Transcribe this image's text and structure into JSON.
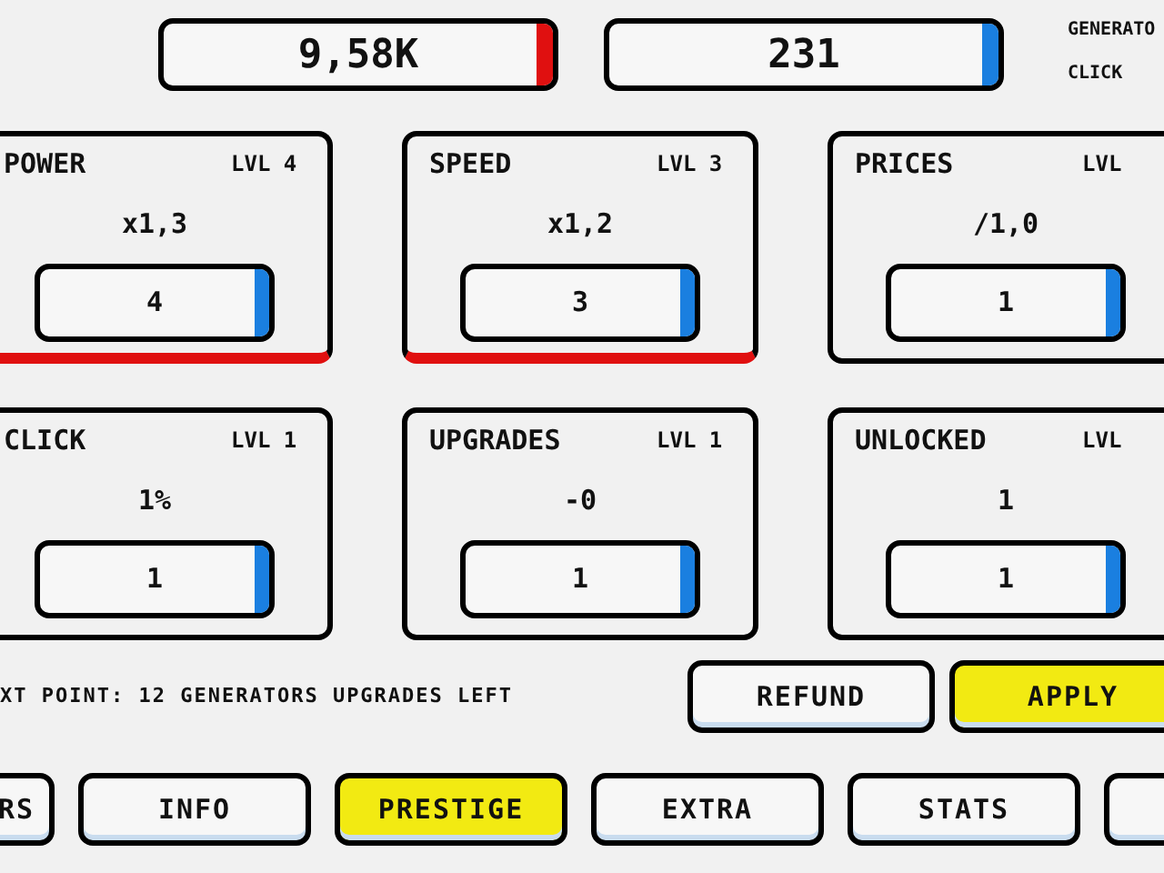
{
  "counters": [
    {
      "value": "9,58K",
      "color": "#e01010"
    },
    {
      "value": "231",
      "color": "#1a7fe0"
    }
  ],
  "counter_labels": [
    "GENERATO",
    "CLICK"
  ],
  "cards": [
    {
      "title": "POWER",
      "level_label": "LVL 4",
      "effect": "x1,3",
      "points": "4",
      "highlighted": true
    },
    {
      "title": "SPEED",
      "level_label": "LVL 3",
      "effect": "x1,2",
      "points": "3",
      "highlighted": true
    },
    {
      "title": "PRICES",
      "level_label": "LVL",
      "effect": "/1,0",
      "points": "1",
      "highlighted": false
    },
    {
      "title": "CLICK",
      "level_label": "LVL 1",
      "effect": "1%",
      "points": "1",
      "highlighted": false
    },
    {
      "title": "UPGRADES",
      "level_label": "LVL 1",
      "effect": "-0",
      "points": "1",
      "highlighted": false
    },
    {
      "title": "UNLOCKED",
      "level_label": "LVL",
      "effect": "1",
      "points": "1",
      "highlighted": false
    }
  ],
  "next_point_text": "XT POINT: 12 GENERATORS UPGRADES LEFT",
  "actions": [
    {
      "label": "REFUND",
      "primary": false
    },
    {
      "label": "APPLY",
      "primary": true
    }
  ],
  "tabs": [
    {
      "label": "RS",
      "selected": false
    },
    {
      "label": "INFO",
      "selected": false
    },
    {
      "label": "PRESTIGE",
      "selected": true
    },
    {
      "label": "EXTRA",
      "selected": false
    },
    {
      "label": "STATS",
      "selected": false
    },
    {
      "selected": false
    }
  ]
}
